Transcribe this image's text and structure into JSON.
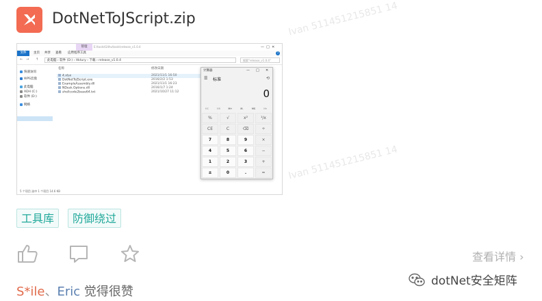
{
  "file": {
    "name": "DotNetToJScript.zip",
    "icon": "file-export-icon",
    "icon_color": "#f26b52"
  },
  "screenshot": {
    "explorer": {
      "manage_tab": "管理",
      "window_path": "E:\\tools\\Githu\\tools\\release_v1.0.4",
      "ribbon": [
        "文件",
        "主页",
        "共享",
        "查看",
        "应用程序工具"
      ],
      "address": "此电脑 › 软件 (D:) › Hktury › 下载 › release_v1.0.4",
      "search_placeholder": "搜索\"release_v1.0.4\"",
      "sidebar": [
        "快速访问",
        "WPS云盘",
        "此电脑",
        "ADH (C:)",
        "软件 (D:)",
        "网络"
      ],
      "columns": {
        "name": "名称",
        "date": "修改日期"
      },
      "files": [
        {
          "name": "4.xlsx",
          "date": "2021/11/1 16:50"
        },
        {
          "name": "DotNetToJScript.exe",
          "date": "2016/2/2 1:53"
        },
        {
          "name": "ExampleAssembly.dll",
          "date": "2021/11/1 16:23"
        },
        {
          "name": "NDesk.Options.dll",
          "date": "2016/1/7 1:24"
        },
        {
          "name": "shellcode2base64.txt",
          "date": "2021/10/27 11:12"
        }
      ],
      "status": "5 个项目    选中 1 个项目  14.6 KB"
    },
    "calculator": {
      "title": "计算器",
      "mode": "标准",
      "display": "0",
      "memory": [
        "MC",
        "MR",
        "M+",
        "M-",
        "MS",
        "M▾"
      ],
      "keys": [
        [
          "%",
          "√",
          "x²",
          "¹/x"
        ],
        [
          "CE",
          "C",
          "⌫",
          "÷"
        ],
        [
          "7",
          "8",
          "9",
          "×"
        ],
        [
          "4",
          "5",
          "6",
          "−"
        ],
        [
          "1",
          "2",
          "3",
          "+"
        ],
        [
          "±",
          "0",
          ".",
          "="
        ]
      ]
    }
  },
  "tags": [
    "工具库",
    "防御绕过"
  ],
  "actions": {
    "like": "thumbs-up-icon",
    "comment": "comment-icon",
    "favorite": "star-icon",
    "details": "查看详情"
  },
  "likes": {
    "user1": "S*ile",
    "separator": "、",
    "user2": "Eric",
    "suffix": "觉得很赞"
  },
  "brand": {
    "name": "dotNet安全矩阵",
    "icon": "wechat-icon"
  },
  "watermark": "Ivan 511451215851 14"
}
